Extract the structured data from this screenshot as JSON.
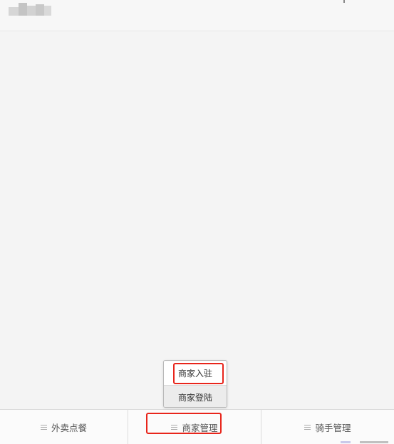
{
  "popup_menu": {
    "items": [
      {
        "label": "商家入驻"
      },
      {
        "label": "商家登陆"
      }
    ]
  },
  "tabbar": {
    "tabs": [
      {
        "label": "外卖点餐",
        "icon": "menu-icon"
      },
      {
        "label": "商家管理",
        "icon": "menu-icon"
      },
      {
        "label": "骑手管理",
        "icon": "menu-icon"
      }
    ]
  },
  "colors": {
    "highlight": "#e8251b",
    "background": "#f4f4f4",
    "tabbar_bg": "#fbfbfb"
  }
}
